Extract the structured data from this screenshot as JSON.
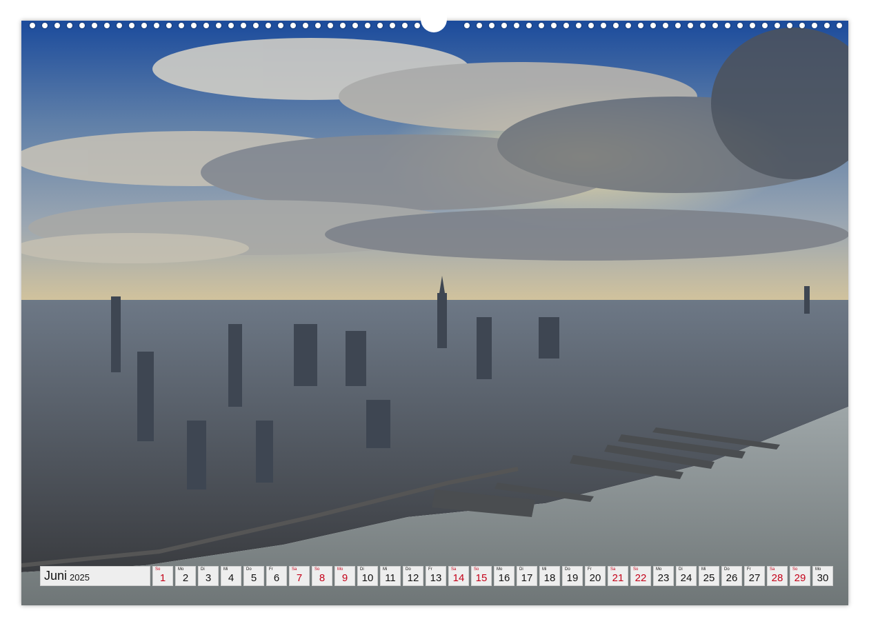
{
  "calendar": {
    "month": "Juni",
    "year": "2025",
    "days": [
      {
        "wd": "So",
        "num": "1",
        "red": true
      },
      {
        "wd": "Mo",
        "num": "2",
        "red": false
      },
      {
        "wd": "Di",
        "num": "3",
        "red": false
      },
      {
        "wd": "Mi",
        "num": "4",
        "red": false
      },
      {
        "wd": "Do",
        "num": "5",
        "red": false
      },
      {
        "wd": "Fr",
        "num": "6",
        "red": false
      },
      {
        "wd": "Sa",
        "num": "7",
        "red": true
      },
      {
        "wd": "So",
        "num": "8",
        "red": true
      },
      {
        "wd": "Mo",
        "num": "9",
        "red": true
      },
      {
        "wd": "Di",
        "num": "10",
        "red": false
      },
      {
        "wd": "Mi",
        "num": "11",
        "red": false
      },
      {
        "wd": "Do",
        "num": "12",
        "red": false
      },
      {
        "wd": "Fr",
        "num": "13",
        "red": false
      },
      {
        "wd": "Sa",
        "num": "14",
        "red": true
      },
      {
        "wd": "So",
        "num": "15",
        "red": true
      },
      {
        "wd": "Mo",
        "num": "16",
        "red": false
      },
      {
        "wd": "Di",
        "num": "17",
        "red": false
      },
      {
        "wd": "Mi",
        "num": "18",
        "red": false
      },
      {
        "wd": "Do",
        "num": "19",
        "red": false
      },
      {
        "wd": "Fr",
        "num": "20",
        "red": false
      },
      {
        "wd": "Sa",
        "num": "21",
        "red": true
      },
      {
        "wd": "So",
        "num": "22",
        "red": true
      },
      {
        "wd": "Mo",
        "num": "23",
        "red": false
      },
      {
        "wd": "Di",
        "num": "24",
        "red": false
      },
      {
        "wd": "Mi",
        "num": "25",
        "red": false
      },
      {
        "wd": "Do",
        "num": "26",
        "red": false
      },
      {
        "wd": "Fr",
        "num": "27",
        "red": false
      },
      {
        "wd": "Sa",
        "num": "28",
        "red": true
      },
      {
        "wd": "So",
        "num": "29",
        "red": true
      },
      {
        "wd": "Mo",
        "num": "30",
        "red": false
      }
    ]
  },
  "colors": {
    "holiday_red": "#c40018",
    "sky_blue": "#1e4f9e",
    "water": "#8a8f8f"
  }
}
